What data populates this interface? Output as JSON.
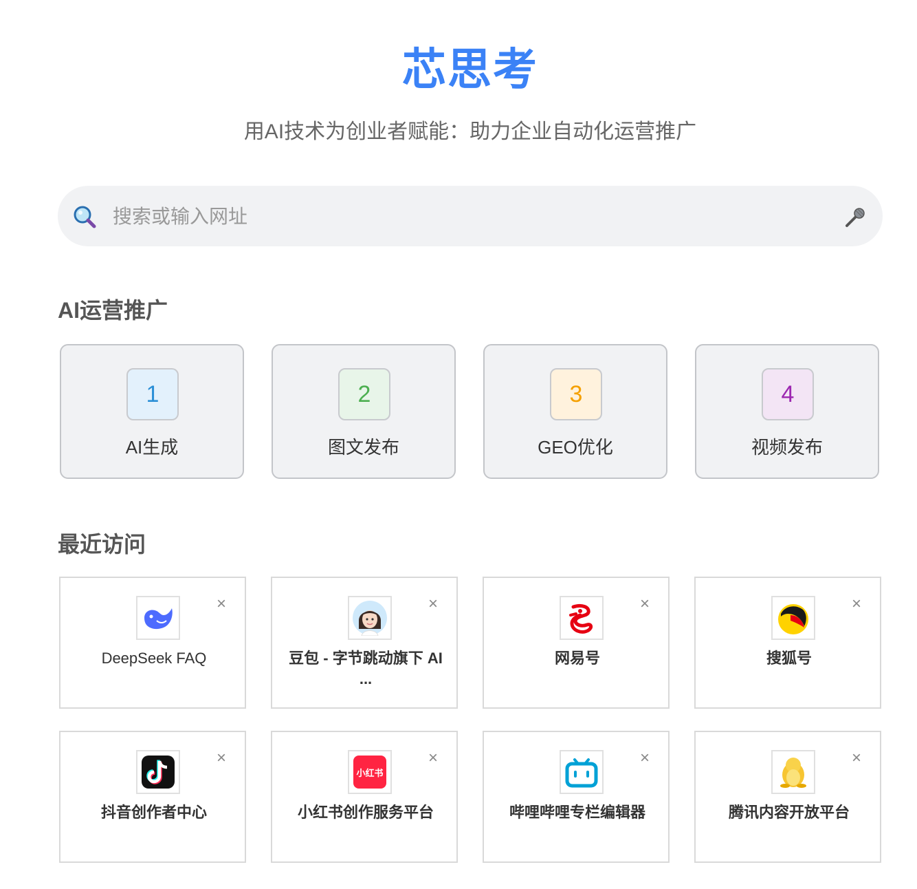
{
  "header": {
    "brand": "芯思考",
    "tagline": "用AI技术为创业者赋能：助力企业自动化运营推广"
  },
  "search": {
    "placeholder": "搜索或输入网址",
    "icon": "search-icon",
    "voice_icon": "microphone-icon"
  },
  "ai_section": {
    "title": "AI运营推广",
    "items": [
      {
        "number": "1",
        "label": "AI生成",
        "num_color": "#2b8fd6",
        "badge_bg": "#e3f1fc"
      },
      {
        "number": "2",
        "label": "图文发布",
        "num_color": "#4caf50",
        "badge_bg": "#e8f5e9"
      },
      {
        "number": "3",
        "label": "GEO优化",
        "num_color": "#f5a000",
        "badge_bg": "#fff2dd"
      },
      {
        "number": "4",
        "label": "视频发布",
        "num_color": "#9c27b0",
        "badge_bg": "#f3e5f5"
      }
    ]
  },
  "recent": {
    "title": "最近访问",
    "close_label": "×",
    "items": [
      {
        "name": "DeepSeek FAQ",
        "icon": "deepseek-whale-icon"
      },
      {
        "name": "豆包 - 字节跳动旗下 AI ...",
        "icon": "doubao-avatar-icon"
      },
      {
        "name": "网易号",
        "icon": "netease-icon"
      },
      {
        "name": "搜狐号",
        "icon": "sohu-fox-icon"
      },
      {
        "name": "抖音创作者中心",
        "icon": "douyin-icon"
      },
      {
        "name": "小红书创作服务平台",
        "icon": "xiaohongshu-icon",
        "icon_text": "小红书"
      },
      {
        "name": "哔哩哔哩专栏编辑器",
        "icon": "bilibili-tv-icon"
      },
      {
        "name": "腾讯内容开放平台",
        "icon": "tencent-penguin-icon"
      }
    ]
  }
}
